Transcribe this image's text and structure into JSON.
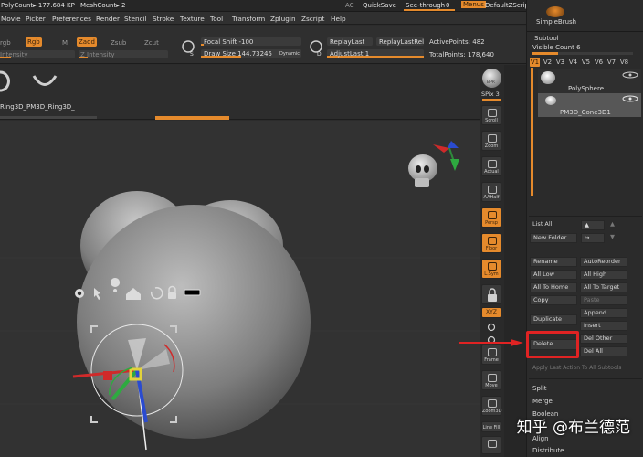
{
  "topbar": {
    "polycount": "PolyCount▸ 177.684 KP",
    "meshcount": "MeshCount▸ 2",
    "ac": "AC",
    "quicksave": "QuickSave",
    "seethrough_label": "See-through",
    "seethrough_value": "0",
    "menus": "Menus",
    "script": "DefaultZScript"
  },
  "menubar": {
    "items": [
      "Movie",
      "Picker",
      "Preferences",
      "Render",
      "Stencil",
      "Stroke",
      "Texture",
      "Tool",
      "Transform",
      "Zplugin",
      "Zscript",
      "Help"
    ]
  },
  "toolbar": {
    "rgb_label": "rgb",
    "rgb_badge": "Rgb",
    "m_label": "M",
    "zadd": "Zadd",
    "zsub": "Zsub",
    "zcut": "Zcut",
    "intensity_left": "Intensity",
    "z_intensity": "Z Intensity",
    "focal_shift": "Focal Shift -100",
    "draw_size": "Draw Size 144.73245",
    "dynamic": "Dynamic",
    "replay_last": "ReplayLast",
    "replay_last_rel": "ReplayLastRel",
    "adjust_last": "AdjustLast 1",
    "active_points": "ActivePoints: 482",
    "total_points": "TotalPoints: 178,640",
    "s_label": "S",
    "d_label": "D"
  },
  "shelf": {
    "tool_name": "Ring3D_PM3D_Ring3D_"
  },
  "rightcol": {
    "bpr": "BPR",
    "spix": "SPix 3",
    "buttons": [
      "Scroll",
      "Zoom",
      "Actual",
      "AAHalf",
      "Persp",
      "Floor",
      "L.Sym",
      "",
      "XYZ",
      "",
      "",
      "Frame",
      "Move",
      "Zoom3D",
      "Line Fill"
    ]
  },
  "panel": {
    "simple_brush": "SimpleBrush",
    "subtool_title": "Subtool",
    "visible_count": "Visible Count 6",
    "vtabs": [
      "V1",
      "V2",
      "V3",
      "V4",
      "V5",
      "V6",
      "V7",
      "V8"
    ],
    "subtools": [
      "PolySphere",
      "PM3D_Cone3D1"
    ],
    "list_all": "List All",
    "new_folder": "New Folder",
    "rename": "Rename",
    "auto_reorder": "AutoReorder",
    "all_low": "All Low",
    "all_high": "All High",
    "all_to_home": "All To Home",
    "all_to_target": "All To Target",
    "copy": "Copy",
    "paste": "Paste",
    "duplicate": "Duplicate",
    "append": "Append",
    "insert": "Insert",
    "delete": "Delete",
    "del_other": "Del Other",
    "del_all": "Del All",
    "apply_last": "Apply Last Action To All Subtools",
    "split": "Split",
    "merge": "Merge",
    "boolean": "Boolean",
    "align": "Align",
    "distribute": "Distribute"
  },
  "watermark": "知乎 @布兰德范",
  "colors": {
    "accent": "#e58a2c",
    "highlight": "#e02323"
  }
}
